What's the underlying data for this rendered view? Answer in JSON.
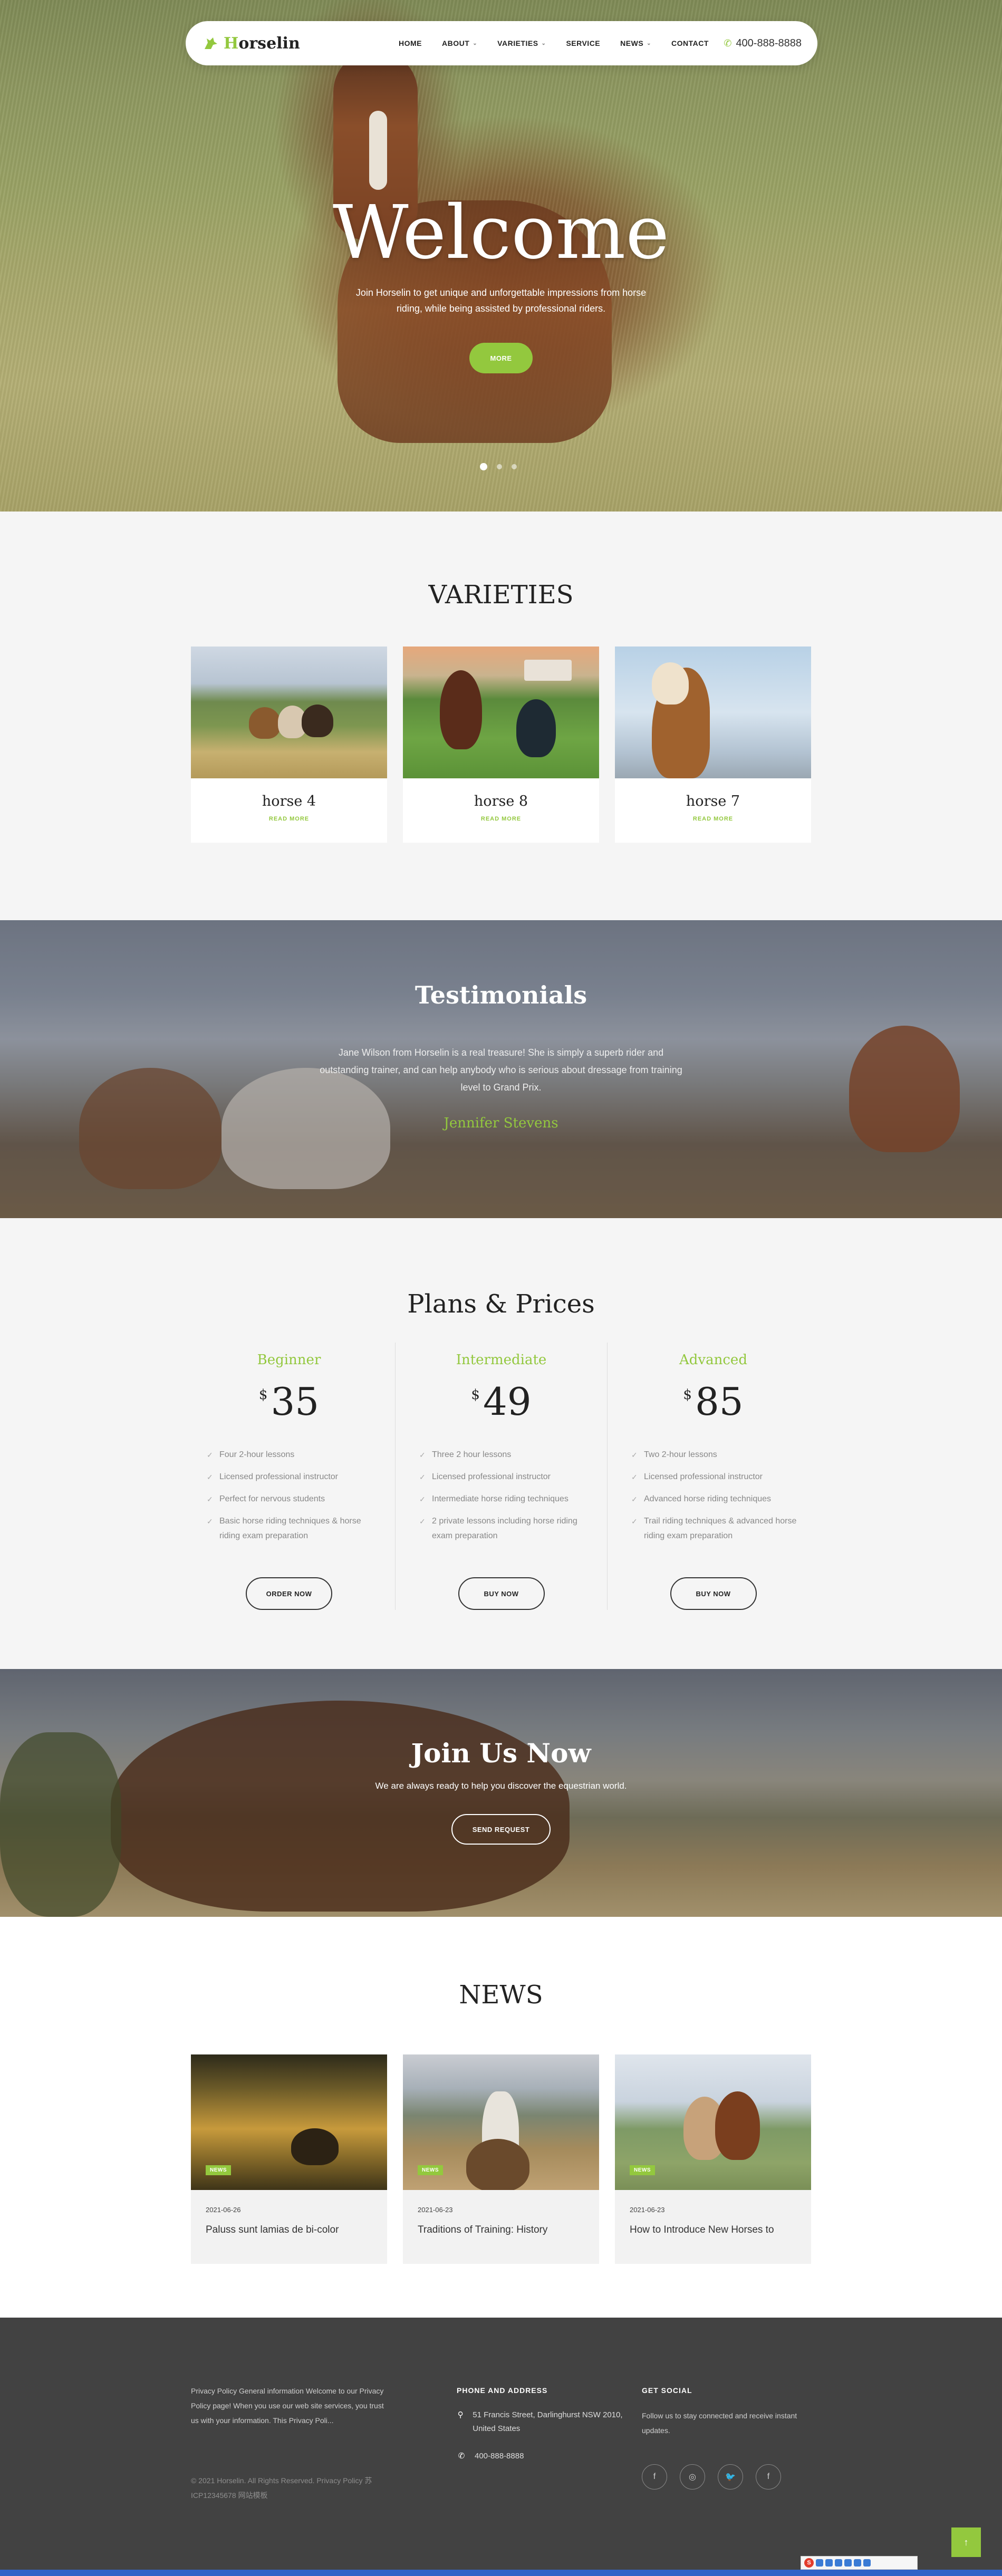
{
  "header": {
    "logo_first_letter": "H",
    "logo_rest": "orselin",
    "nav": [
      {
        "label": "HOME",
        "dropdown": false
      },
      {
        "label": "ABOUT",
        "dropdown": true
      },
      {
        "label": "VARIETIES",
        "dropdown": true
      },
      {
        "label": "SERVICE",
        "dropdown": false
      },
      {
        "label": "NEWS",
        "dropdown": true
      },
      {
        "label": "CONTACT",
        "dropdown": false
      }
    ],
    "phone": "400-888-8888"
  },
  "hero": {
    "title": "Welcome",
    "text": "Join Horselin to get unique and unforgettable impressions from horse riding, while being assisted by professional riders.",
    "button": "MORE",
    "slides": 3,
    "active_slide": 1
  },
  "varieties": {
    "title": "VARIETIES",
    "cards": [
      {
        "name": "horse 4",
        "link": "READ MORE"
      },
      {
        "name": "horse 8",
        "link": "READ MORE"
      },
      {
        "name": "horse 7",
        "link": "READ MORE"
      }
    ]
  },
  "testimonials": {
    "title": "Testimonials",
    "quote": "Jane Wilson from Horselin is a real treasure! She is simply a superb rider and outstanding trainer, and can help anybody who is serious about dressage from training level to Grand Prix.",
    "author": "Jennifer Stevens"
  },
  "plans": {
    "title": "Plans & Prices",
    "currency": "$",
    "items": [
      {
        "name": "Beginner",
        "price": "35",
        "features": [
          "Four 2-hour lessons",
          "Licensed professional instructor",
          "Perfect for nervous students",
          "Basic horse riding techniques & horse riding exam preparation"
        ],
        "button": "ORDER NOW"
      },
      {
        "name": "Intermediate",
        "price": "49",
        "features": [
          "Three 2 hour lessons",
          "Licensed professional instructor",
          "Intermediate horse riding techniques",
          "2 private lessons including horse riding exam preparation"
        ],
        "button": "BUY NOW"
      },
      {
        "name": "Advanced",
        "price": "85",
        "features": [
          "Two 2-hour lessons",
          "Licensed professional instructor",
          "Advanced horse riding techniques",
          "Trail riding techniques & advanced horse riding exam preparation"
        ],
        "button": "BUY NOW"
      }
    ]
  },
  "join": {
    "title": "Join Us Now",
    "text": "We are always ready to help you discover the equestrian world.",
    "button": "SEND REQUEST"
  },
  "news": {
    "title": "NEWS",
    "items": [
      {
        "tag": "NEWS",
        "date": "2021-06-26",
        "title": "Paluss sunt lamias de bi-color"
      },
      {
        "tag": "NEWS",
        "date": "2021-06-23",
        "title": "Traditions of Training: History"
      },
      {
        "tag": "NEWS",
        "date": "2021-06-23",
        "title": "How to Introduce New Horses to"
      }
    ]
  },
  "footer": {
    "about": "Privacy Policy General information Welcome to our Privacy Policy page! When you use our web site services, you trust us with your information. This Privacy Poli...",
    "copyright": "© 2021 Horselin. All Rights Reserved. Privacy Policy 苏ICP12345678 网站模板",
    "contact_title": "PHONE AND ADDRESS",
    "address": "51 Francis Street, Darlinghurst NSW 2010, United States",
    "phone": "400-888-8888",
    "social_title": "GET SOCIAL",
    "social_text": "Follow us to stay connected and receive instant updates.",
    "social_icons": [
      "facebook-icon",
      "instagram-icon",
      "twitter-icon",
      "facebook-icon"
    ]
  },
  "colors": {
    "accent": "#93c83e",
    "footer_bg": "#424242",
    "section_bg": "#f5f5f5"
  }
}
